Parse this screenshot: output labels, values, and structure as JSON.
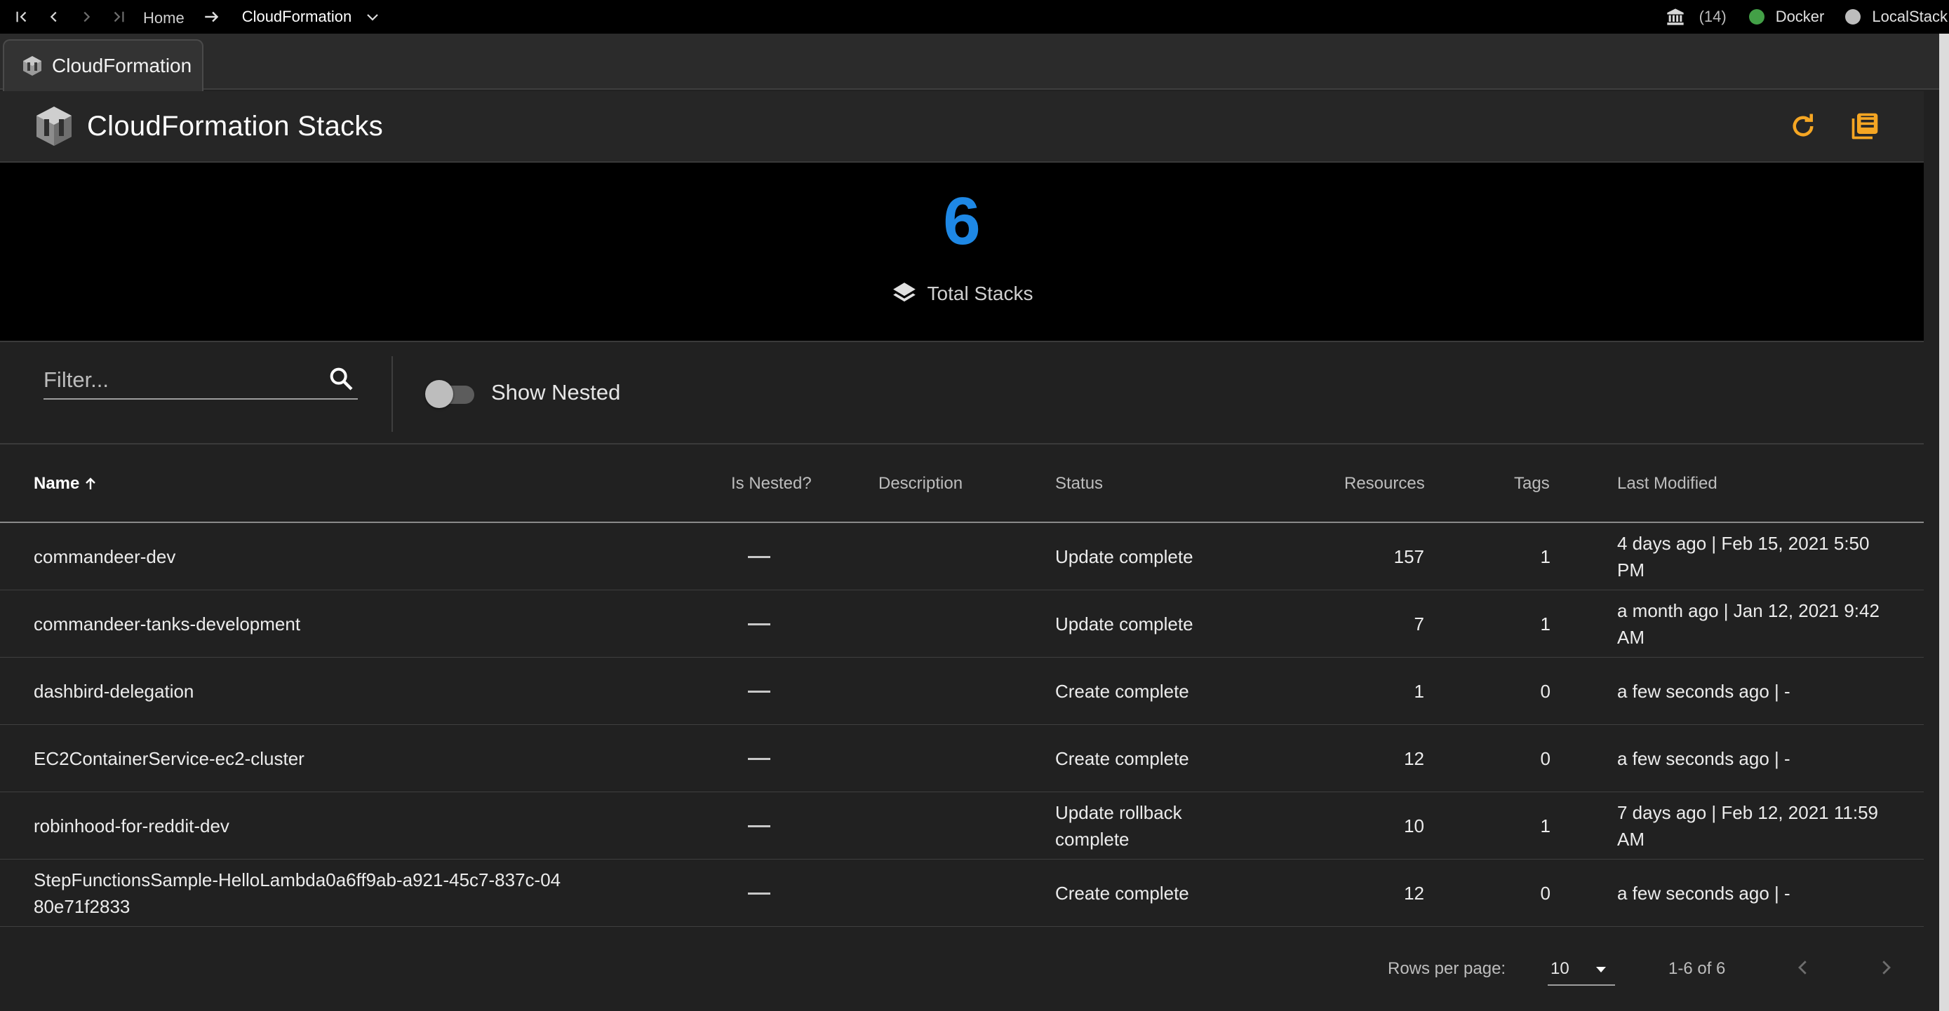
{
  "topbar": {
    "breadcrumb_home": "Home",
    "breadcrumb_current": "CloudFormation",
    "notification_count": "(14)",
    "docker_label": "Docker",
    "docker_status_color": "#43a047",
    "localstack_label": "LocalStack",
    "localstack_status_color": "#bdbdbd"
  },
  "tab": {
    "label": "CloudFormation"
  },
  "header": {
    "title": "CloudFormation Stacks",
    "accent_color": "#f5a623",
    "actions": [
      "refresh-icon",
      "logs-icon"
    ]
  },
  "stats": {
    "total": "6",
    "label": "Total Stacks",
    "number_color": "#1e88e5",
    "icon": "layers-icon"
  },
  "filter": {
    "placeholder": "Filter...",
    "toggle_label": "Show Nested",
    "toggle_on": false
  },
  "table": {
    "columns": [
      "Name",
      "Is Nested?",
      "Description",
      "Status",
      "Resources",
      "Tags",
      "Last Modified"
    ],
    "sort": {
      "column": "Name",
      "direction": "asc"
    },
    "rows": [
      {
        "name": "commandeer-dev",
        "is_nested": "—",
        "description": "",
        "status": "Update complete",
        "resources": "157",
        "tags": "1",
        "last_modified": "4 days ago | Feb 15, 2021 5:50 PM"
      },
      {
        "name": "commandeer-tanks-development",
        "is_nested": "—",
        "description": "",
        "status": "Update complete",
        "resources": "7",
        "tags": "1",
        "last_modified": "a month ago | Jan 12, 2021 9:42 AM"
      },
      {
        "name": "dashbird-delegation",
        "is_nested": "—",
        "description": "",
        "status": "Create complete",
        "resources": "1",
        "tags": "0",
        "last_modified": "a few seconds ago | -"
      },
      {
        "name": "EC2ContainerService-ec2-cluster",
        "is_nested": "—",
        "description": "",
        "status": "Create complete",
        "resources": "12",
        "tags": "0",
        "last_modified": "a few seconds ago | -"
      },
      {
        "name": "robinhood-for-reddit-dev",
        "is_nested": "—",
        "description": "",
        "status": "Update rollback complete",
        "resources": "10",
        "tags": "1",
        "last_modified": "7 days ago | Feb 12, 2021 11:59 AM"
      },
      {
        "name": "StepFunctionsSample-HelloLambda0a6ff9ab-a921-45c7-837c-0480e71f2833",
        "is_nested": "—",
        "description": "",
        "status": "Create complete",
        "resources": "12",
        "tags": "0",
        "last_modified": "a few seconds ago | -"
      }
    ]
  },
  "pagination": {
    "rows_per_page_label": "Rows per page:",
    "rows_per_page": "10",
    "range": "1-6 of 6"
  }
}
